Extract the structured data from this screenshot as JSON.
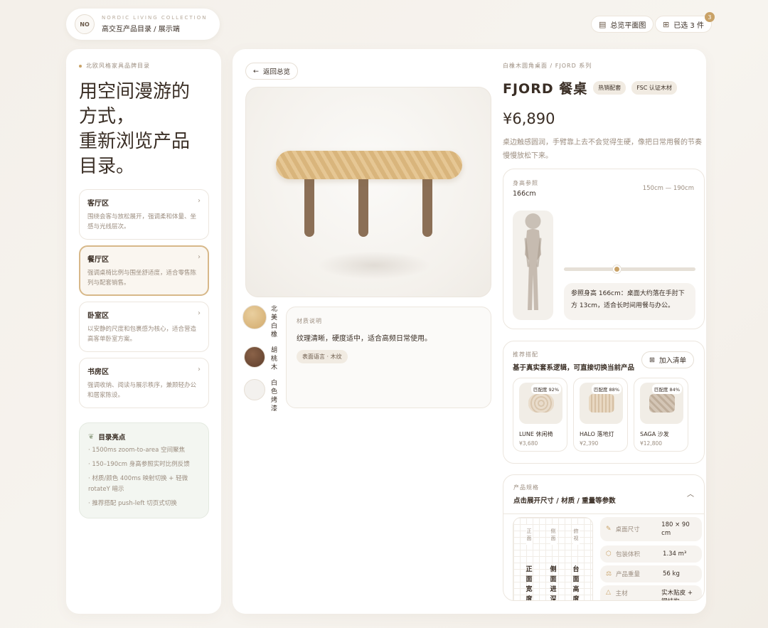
{
  "brand": {
    "badge": "NO",
    "top": "NORDIC LIVING COLLECTION",
    "subtitle": "高交互产品目录 / 展示端"
  },
  "topbar": {
    "floorplan_label": "总览平面图",
    "cart_label": "已选 3 件",
    "cart_count": "3"
  },
  "sidebar": {
    "crumb": "北欧风格家具品牌目录",
    "hero_lines": [
      "用空间漫游的",
      "方式，",
      "重新浏览产品",
      "目录。"
    ],
    "zones": [
      {
        "title": "客厅区",
        "desc": "围绕会客与放松展开，强调柔和体量、坐感与光线层次。"
      },
      {
        "title": "餐厅区",
        "desc": "强调桌椅比例与围坐舒适度，适合零售陈列与配套销售。"
      },
      {
        "title": "卧室区",
        "desc": "以安静的尺度和包裹感为核心，适合营造高客单卧室方案。"
      },
      {
        "title": "书房区",
        "desc": "强调收纳、阅读与展示秩序，兼顾轻办公和居家陈设。"
      }
    ],
    "highlights": {
      "title": "目录亮点",
      "items": [
        "1500ms zoom-to-area 空间聚焦",
        "150–190cm 身高参照实时比例反馈",
        "材质/颜色 400ms 映射切换 + 轻微 rotateY 暗示",
        "推荐搭配 push-left 切页式切换"
      ]
    }
  },
  "viewer": {
    "back_label": "返回总览",
    "swatches": [
      {
        "label": "北美白橡",
        "color": "#d8b47a"
      },
      {
        "label": "胡桃木",
        "color": "#6e4b35"
      },
      {
        "label": "白色烤漆",
        "color": "#f3f1ee"
      }
    ],
    "material": {
      "label": "材质说明",
      "text": "纹理清晰，硬度适中，适合高频日常使用。",
      "tag": "表面语言 · 木纹"
    }
  },
  "product": {
    "crumb": "白橡木圆角桌面 / FJORD 系列",
    "title": "FJORD 餐桌",
    "tags": [
      "热销配套",
      "FSC 认证木材"
    ],
    "price": "¥6,890",
    "desc": "桌边触感圆润，手臂靠上去不会觉得生硬，像把日常用餐的节奏慢慢放松下来。"
  },
  "height_ref": {
    "label": "身高参照",
    "value": "166cm",
    "range": "150cm — 190cm",
    "slider_fraction": 0.4,
    "note": "参照身高 166cm：桌面大约落在手肘下方 13cm，适合长时间用餐与办公。"
  },
  "recommend": {
    "label": "推荐搭配",
    "title": "基于真实套系逻辑，可直接切换当前产品",
    "add_label": "加入清单",
    "items": [
      {
        "match": "匹配度 92%",
        "name": "LUNE 休闲椅",
        "price": "¥3,680"
      },
      {
        "match": "匹配度 88%",
        "name": "HALO 落地灯",
        "price": "¥2,390"
      },
      {
        "match": "匹配度 84%",
        "name": "SAGA 沙发",
        "price": "¥12,800"
      }
    ]
  },
  "specs": {
    "label": "产品规格",
    "title": "点击展开尺寸 / 材质 / 重量等参数",
    "views": [
      {
        "tag": "正面",
        "big": "正面宽度"
      },
      {
        "tag": "侧面",
        "big": "侧面进深"
      },
      {
        "tag": "俯视",
        "big": "台面高度"
      }
    ],
    "rows": [
      {
        "key": "桌面尺寸",
        "value": "180 × 90 cm"
      },
      {
        "key": "包装体积",
        "value": "1.34 m³"
      },
      {
        "key": "产品重量",
        "value": "56 kg"
      },
      {
        "key": "主材",
        "value": "实木贴皮 + 钢结构"
      }
    ]
  },
  "colors": {
    "accent": "#c9a267",
    "text": "#3a2e25",
    "muted": "#9c8e80"
  }
}
